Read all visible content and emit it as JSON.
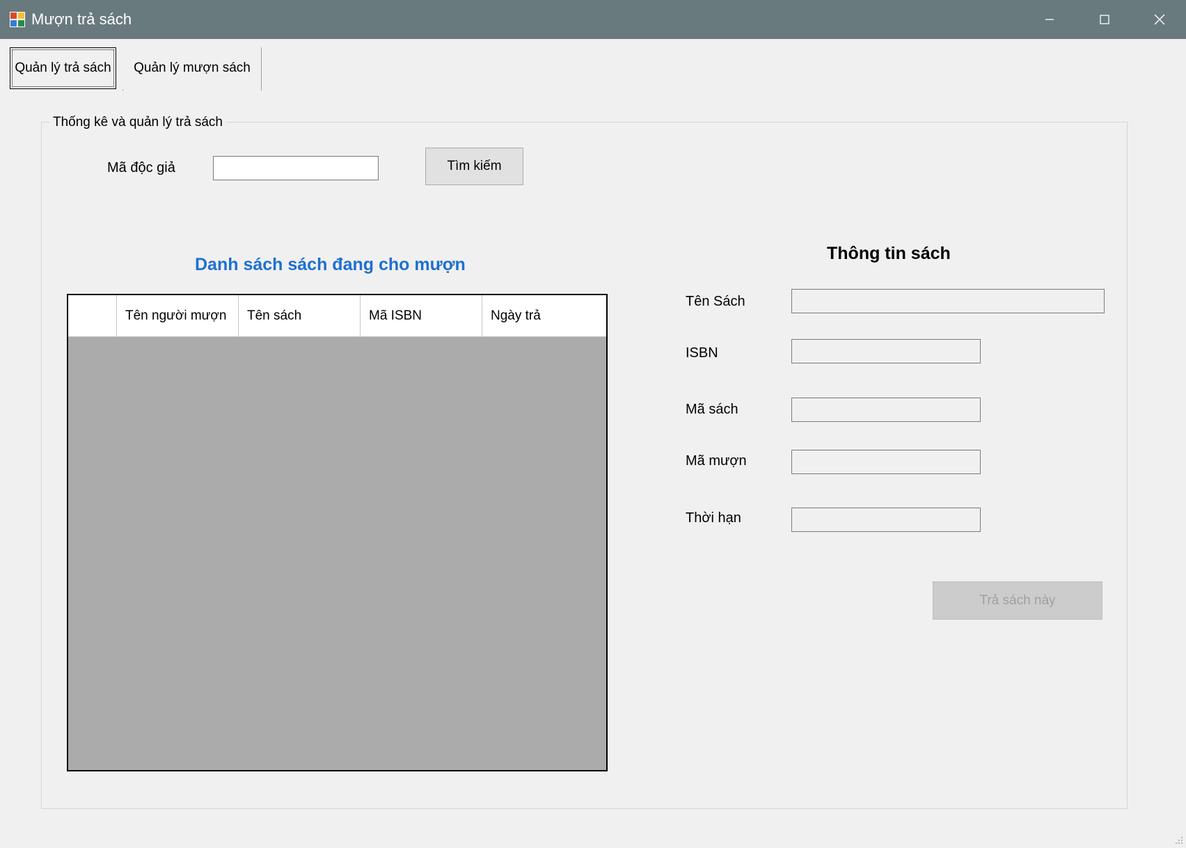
{
  "window": {
    "title": "Mượn trả sách",
    "controls": [
      "minimize-icon",
      "maximize-icon",
      "close-icon"
    ]
  },
  "tabs": [
    {
      "label": "Quản lý trả sách",
      "active": true
    },
    {
      "label": "Quản lý mượn sách",
      "active": false
    }
  ],
  "group": {
    "title": "Thống kê và quản lý trả sách"
  },
  "search": {
    "label": "Mã độc giả",
    "value": "",
    "button_label": "Tìm kiếm"
  },
  "list": {
    "title": "Danh sách sách đang cho mượn",
    "columns": [
      "",
      "Tên người mượn",
      "Tên sách",
      "Mã ISBN",
      "Ngày trả"
    ],
    "rows": []
  },
  "info": {
    "title": "Thông tin sách",
    "fields": [
      {
        "label": "Tên Sách",
        "value": ""
      },
      {
        "label": "ISBN",
        "value": ""
      },
      {
        "label": "Mã sách",
        "value": ""
      },
      {
        "label": "Mã mượn",
        "value": ""
      },
      {
        "label": "Thời hạn",
        "value": ""
      }
    ],
    "return_button_label": "Trả sách này"
  },
  "colors": {
    "titlebar": "#697a7e",
    "list_title": "#1e70d0",
    "grid_background": "#ababab"
  }
}
